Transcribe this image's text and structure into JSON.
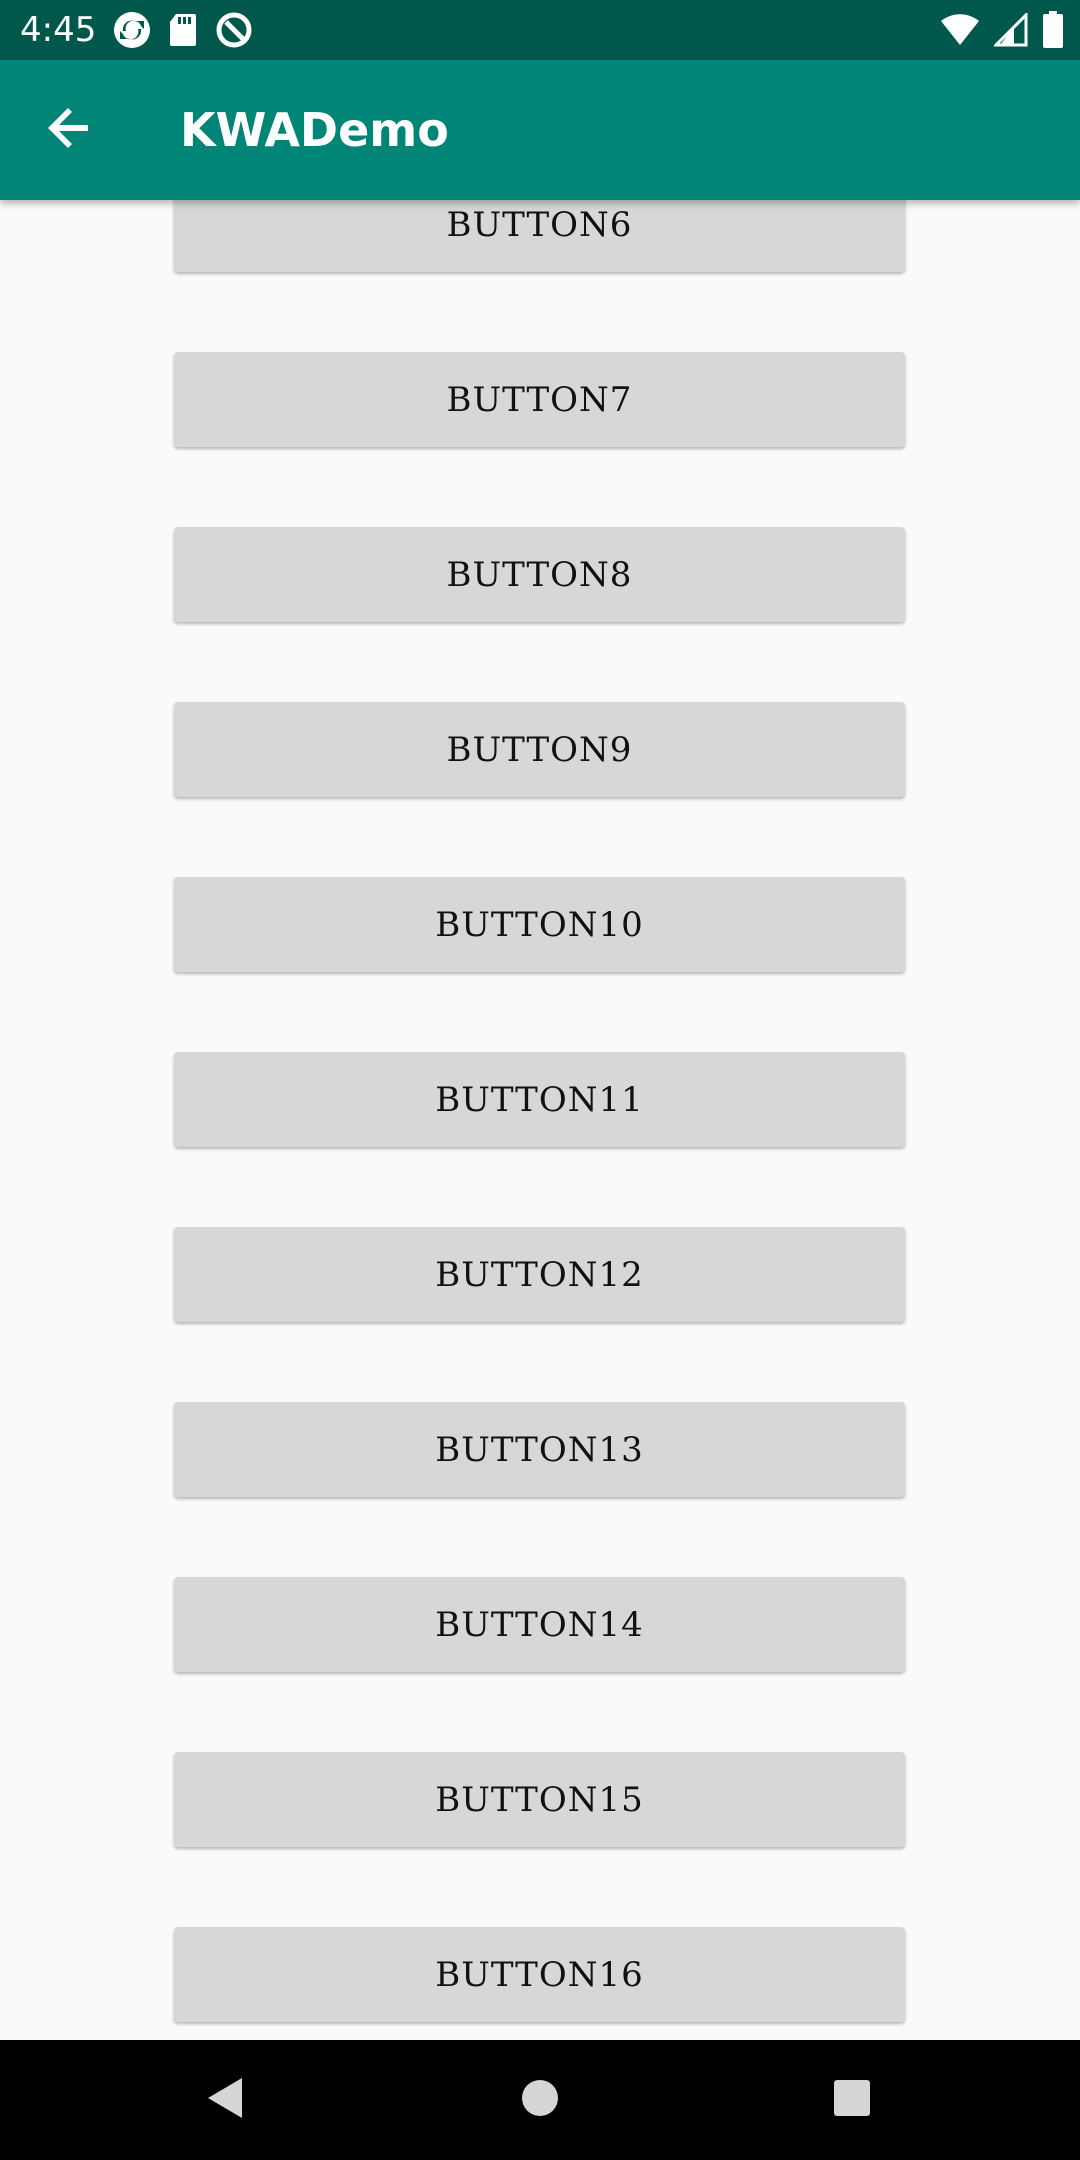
{
  "status_bar": {
    "time": "4:45",
    "left_icons": [
      "sync-icon",
      "sd-card-icon",
      "data-saver-icon"
    ],
    "right_icons": [
      "wifi-icon",
      "cell-signal-icon",
      "battery-icon"
    ]
  },
  "app_bar": {
    "title": "KWADemo",
    "back_icon": "arrow-back-icon",
    "background": "#008577"
  },
  "buttons": [
    {
      "label": "BUTTON6"
    },
    {
      "label": "BUTTON7"
    },
    {
      "label": "BUTTON8"
    },
    {
      "label": "BUTTON9"
    },
    {
      "label": "BUTTON10"
    },
    {
      "label": "BUTTON11"
    },
    {
      "label": "BUTTON12"
    },
    {
      "label": "BUTTON13"
    },
    {
      "label": "BUTTON14"
    },
    {
      "label": "BUTTON15"
    },
    {
      "label": "BUTTON16"
    }
  ],
  "nav_bar": {
    "icons": [
      "back-triangle-icon",
      "home-circle-icon",
      "recents-square-icon"
    ]
  }
}
